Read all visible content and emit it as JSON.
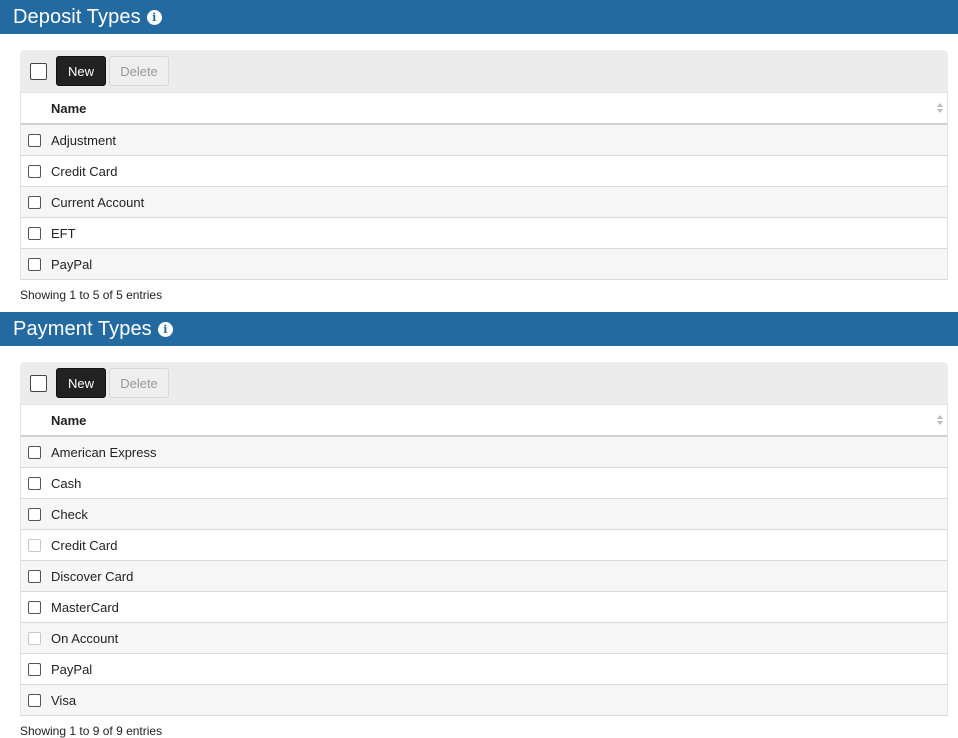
{
  "deposit": {
    "title": "Deposit Types",
    "new_label": "New",
    "delete_label": "Delete",
    "column_name": "Name",
    "rows": [
      {
        "name": "Adjustment"
      },
      {
        "name": "Credit Card"
      },
      {
        "name": "Current Account"
      },
      {
        "name": "EFT"
      },
      {
        "name": "PayPal"
      }
    ],
    "footer": "Showing 1 to 5 of 5 entries"
  },
  "payment": {
    "title": "Payment Types",
    "new_label": "New",
    "delete_label": "Delete",
    "column_name": "Name",
    "rows": [
      {
        "name": "American Express",
        "disabled": false
      },
      {
        "name": "Cash",
        "disabled": false
      },
      {
        "name": "Check",
        "disabled": false
      },
      {
        "name": "Credit Card",
        "disabled": true
      },
      {
        "name": "Discover Card",
        "disabled": false
      },
      {
        "name": "MasterCard",
        "disabled": false
      },
      {
        "name": "On Account",
        "disabled": true
      },
      {
        "name": "PayPal",
        "disabled": false
      },
      {
        "name": "Visa",
        "disabled": false
      }
    ],
    "footer": "Showing 1 to 9 of 9 entries"
  },
  "info_icon_glyph": "i",
  "colors": {
    "header_bg": "#236aa0",
    "toolbar_bg": "#ececec",
    "new_button_bg": "#222222"
  }
}
